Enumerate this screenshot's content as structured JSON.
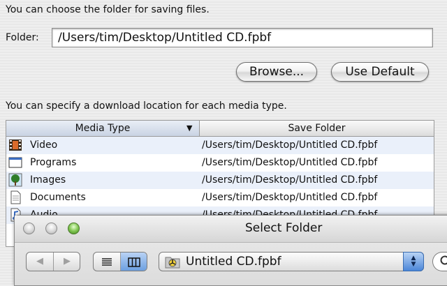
{
  "prefs": {
    "intro_text": "You can choose the folder for saving files.",
    "folder_label": "Folder:",
    "folder_value": "/Users/tim/Desktop/Untitled CD.fpbf",
    "browse_label": "Browse...",
    "use_default_label": "Use Default",
    "media_intro": "You can specify a download location for each media type."
  },
  "table": {
    "col_media": "Media Type",
    "col_save": "Save Folder",
    "rows": [
      {
        "name": "Video",
        "path": "/Users/tim/Desktop/Untitled CD.fpbf",
        "icon": "film-icon"
      },
      {
        "name": "Programs",
        "path": "/Users/tim/Desktop/Untitled CD.fpbf",
        "icon": "application-window-icon"
      },
      {
        "name": "Images",
        "path": "/Users/tim/Desktop/Untitled CD.fpbf",
        "icon": "tree-picture-icon"
      },
      {
        "name": "Documents",
        "path": "/Users/tim/Desktop/Untitled CD.fpbf",
        "icon": "document-icon"
      },
      {
        "name": "Audio",
        "path": "/Users/tim/Desktop/Untitled CD.fpbf",
        "icon": "music-note-icon"
      }
    ]
  },
  "sheet": {
    "title": "Select Folder",
    "popup_value": "Untitled CD.fpbf"
  },
  "colors": {
    "selection_blue": "#6c9fe0",
    "zoom_green": "#82c653"
  }
}
